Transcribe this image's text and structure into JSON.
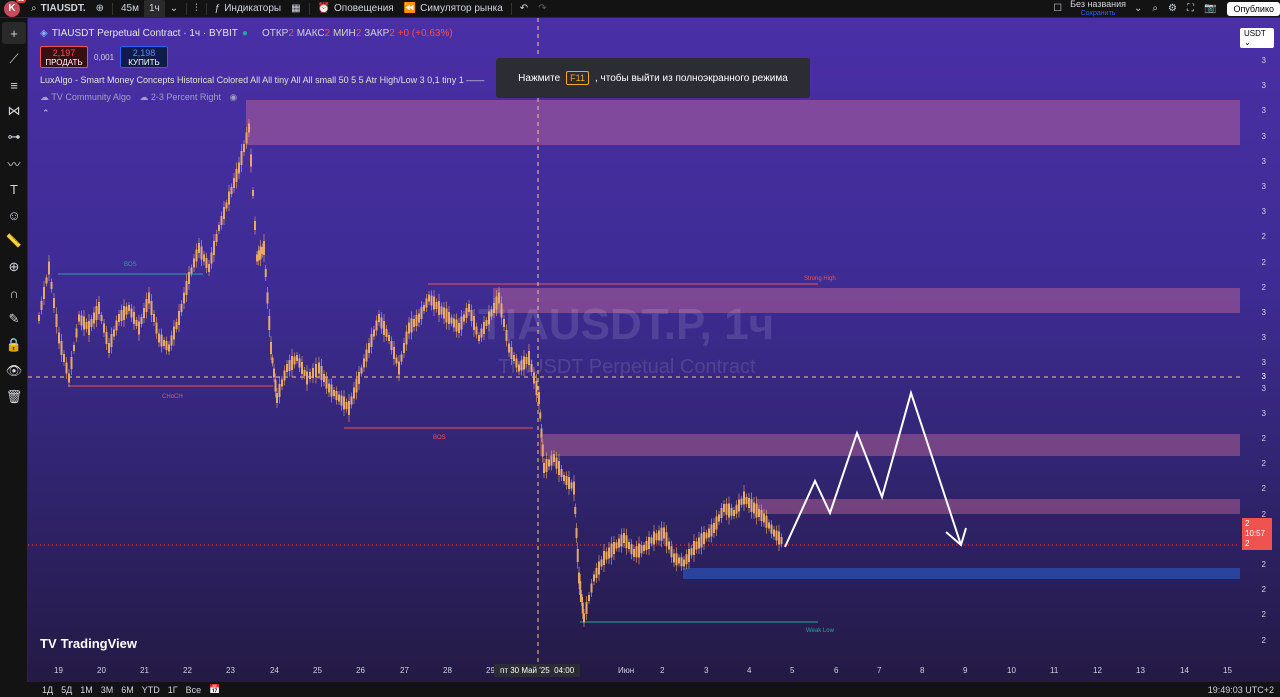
{
  "topbar": {
    "avatar_letter": "K",
    "avatar_badge": "11",
    "symbol": "TIAUSDT.",
    "intervals": [
      "45м",
      "1ч"
    ],
    "indicators_label": "Индикаторы",
    "alerts_label": "Оповещения",
    "replay_label": "Симулятор рынка",
    "layout_name": "Без названия",
    "layout_saved": "Сохранить",
    "publish_label": "Опублико"
  },
  "legend": {
    "title": "TIAUSDT Perpetual Contract · 1ч · BYBIT",
    "o_label": "ОТКР",
    "o_value": "2",
    "h_label": "МАКС",
    "h_value": "2",
    "l_label": "МИН",
    "l_value": "2",
    "c_label": "ЗАКР",
    "c_value": "2",
    "change": "+0 (+0,63%)"
  },
  "trade": {
    "sell_price": "2,197",
    "sell_label": "ПРОДАТЬ",
    "spread": "0,001",
    "buy_price": "2,198",
    "buy_label": "КУПИТЬ"
  },
  "indicator": {
    "line1": "LuxAlgo - Smart Money Concepts Historical Colored All All tiny All All small 50 5 5 Atr High/Low 3 0,1 tiny 1 ——",
    "line2a": "TV Community Algo",
    "line2b": "2-3 Percent Right"
  },
  "toast": {
    "before": "Нажмите",
    "key": "F11",
    "after": ", чтобы выйти из полноэкранного режима"
  },
  "watermark": {
    "symbol": "TIAUSDT.P, 1ч",
    "name": "TIAUSDT Perpetual Contract"
  },
  "logo": "TradingView",
  "yaxis": {
    "currency": "USDT",
    "labels": [
      "3",
      "3",
      "3",
      "3",
      "3",
      "3",
      "3",
      "2",
      "2",
      "2",
      "3",
      "3",
      "3",
      "3",
      "3",
      "2",
      "2",
      "2",
      "2",
      "2",
      "2",
      "2",
      "2",
      "2"
    ],
    "crosshair_value": "3",
    "last_price": "2",
    "countdown": "10:57",
    "last_price2": "2"
  },
  "xaxis": {
    "labels": [
      "19",
      "20",
      "21",
      "22",
      "23",
      "24",
      "25",
      "26",
      "27",
      "28",
      "29",
      "Июн",
      "2",
      "3",
      "4",
      "5",
      "6",
      "7",
      "8",
      "9",
      "10",
      "11",
      "12",
      "13",
      "14",
      "15"
    ],
    "crosshair_date": "пт 30 Май '25",
    "crosshair_time": "04:00"
  },
  "bottombar": {
    "ranges": [
      "1Д",
      "5Д",
      "1М",
      "3М",
      "6М",
      "YTD",
      "1Г",
      "Все"
    ],
    "time": "19:49:03 UTC+2"
  },
  "annotations": {
    "bos": "BOS",
    "choch": "CHoCH",
    "strong_high": "Strong High",
    "weak_low": "Weak Low"
  },
  "colors": {
    "bg_top": "#4a2fa6",
    "bg_bottom": "#241a44",
    "candle": "#e8a868",
    "zone_pink": "#c86a9a",
    "zone_blue": "#2a4aa8",
    "drawing": "#ffffff"
  }
}
